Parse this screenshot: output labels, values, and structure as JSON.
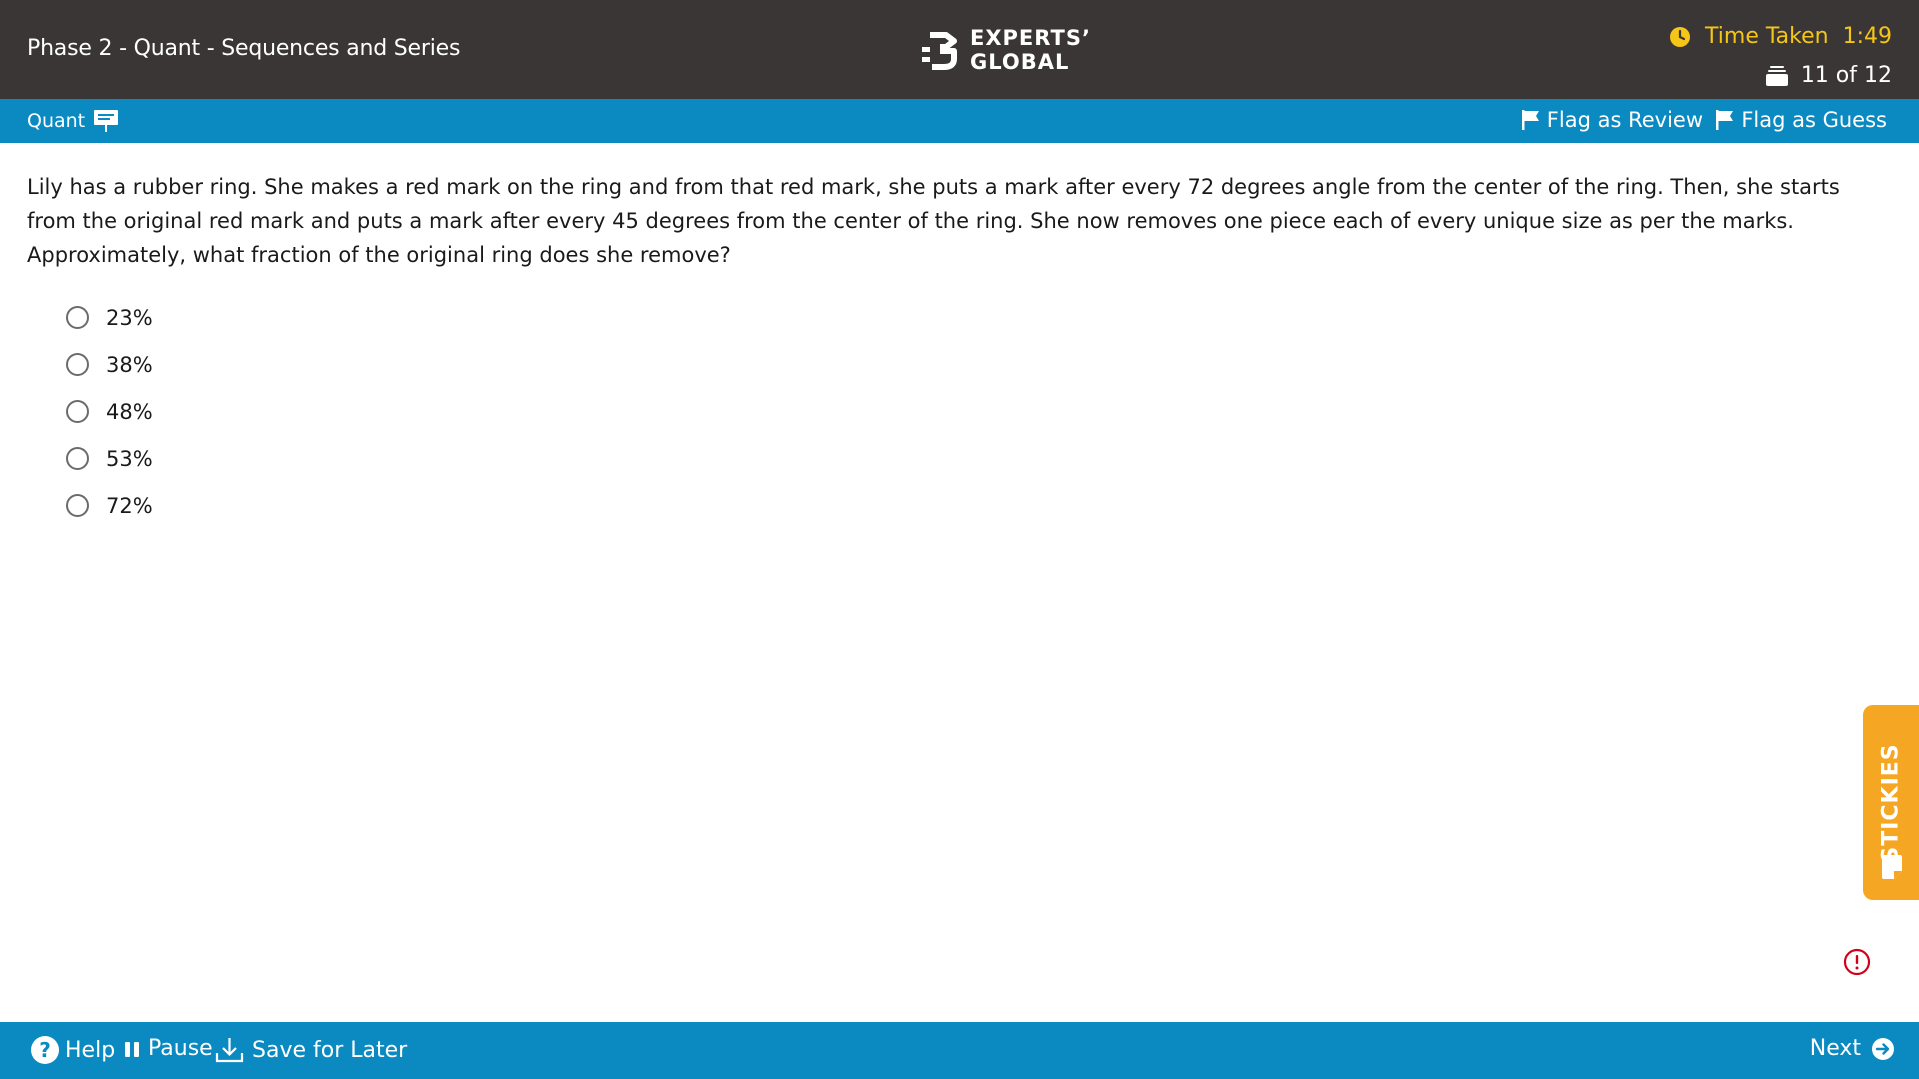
{
  "header": {
    "test_title": "Phase 2 - Quant - Sequences and Series",
    "logo_line1": "EXPERTS’",
    "logo_line2": "GLOBAL",
    "timer_label": "Time Taken",
    "timer_value": "1:49",
    "question_counter": "11 of 12",
    "timer_color": "#f5c518"
  },
  "section_bar": {
    "section_name": "Quant",
    "flag_review_label": "Flag as Review",
    "flag_guess_label": "Flag as Guess"
  },
  "question": {
    "text": "Lily has a rubber ring. She makes a red mark on the ring and from that red mark, she puts a mark after every 72 degrees angle from the center of the ring. Then, she starts from the original red mark and puts a mark after every 45 degrees from the center of the ring. She now removes one piece each of every unique size as per the marks. Approximately, what fraction of the original ring does she remove?",
    "options": [
      "23%",
      "38%",
      "48%",
      "53%",
      "72%"
    ],
    "selected": null
  },
  "stickies": {
    "label": "STICKIES"
  },
  "footer": {
    "help_label": "Help",
    "pause_label": "Pause",
    "save_label": "Save for Later",
    "next_label": "Next"
  },
  "colors": {
    "top_bar": "#3a3636",
    "accent_bar": "#0b8ac2",
    "stickies": "#f5a623",
    "report_icon": "#d0021b"
  }
}
